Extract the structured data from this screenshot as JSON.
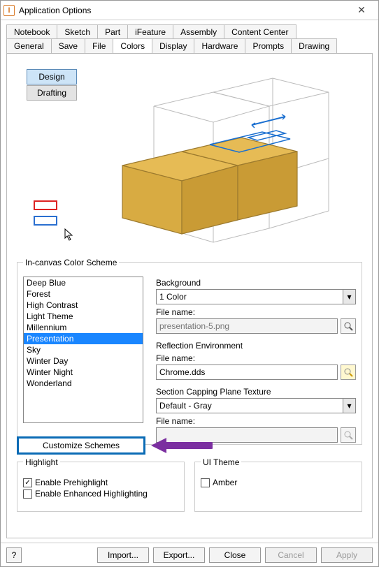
{
  "window": {
    "title": "Application Options"
  },
  "tabs_row1": [
    "Notebook",
    "Sketch",
    "Part",
    "iFeature",
    "Assembly",
    "Content Center"
  ],
  "tabs_row2": [
    "General",
    "Save",
    "File",
    "Colors",
    "Display",
    "Hardware",
    "Prompts",
    "Drawing"
  ],
  "active_tab": "Colors",
  "mode": {
    "design": "Design",
    "drafting": "Drafting"
  },
  "swatches": {
    "red": "#d22",
    "blue": "#2a6fd0"
  },
  "scheme": {
    "legend": "In-canvas Color Scheme",
    "items": [
      "Deep Blue",
      "Forest",
      "High Contrast",
      "Light Theme",
      "Millennium",
      "Presentation",
      "Sky",
      "Winter Day",
      "Winter Night",
      "Wonderland"
    ],
    "selected": "Presentation"
  },
  "background": {
    "label": "Background",
    "value": "1 Color",
    "file_label": "File name:",
    "file_value": "presentation-5.png"
  },
  "reflection": {
    "label": "Reflection Environment",
    "file_label": "File name:",
    "file_value": "Chrome.dds"
  },
  "section": {
    "label": "Section Capping Plane Texture",
    "value": "Default - Gray",
    "file_label": "File name:",
    "file_value": ""
  },
  "customize": {
    "label": "Customize Schemes"
  },
  "highlight": {
    "legend": "Highlight",
    "prehighlight": "Enable Prehighlight",
    "enhanced": "Enable Enhanced Highlighting"
  },
  "uitheme": {
    "legend": "UI Theme",
    "amber": "Amber"
  },
  "buttons": {
    "help": "?",
    "import": "Import...",
    "export": "Export...",
    "close": "Close",
    "cancel": "Cancel",
    "apply": "Apply"
  }
}
